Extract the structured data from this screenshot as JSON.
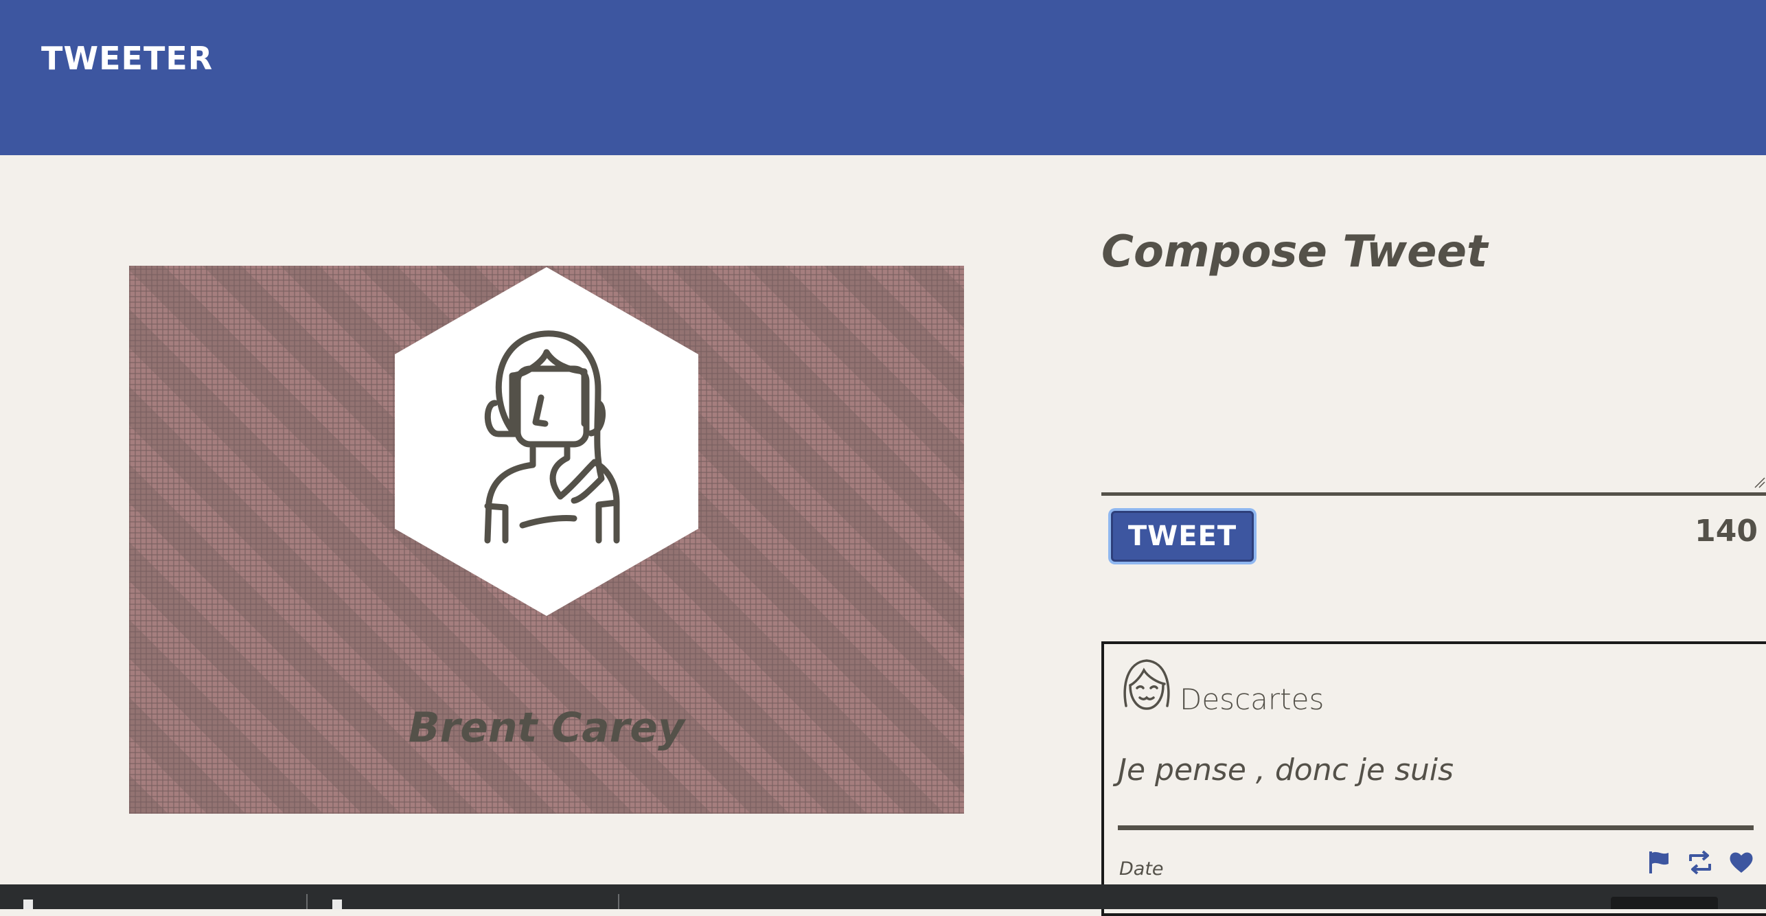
{
  "header": {
    "brand": "TWEETER",
    "color": "#3d56a0"
  },
  "profile": {
    "name": "Brent Carey",
    "avatar_icon": "woman-avatar-icon"
  },
  "compose": {
    "title": "Compose Tweet",
    "text": "",
    "button_label": "TWEET",
    "char_count": "140"
  },
  "tweets": [
    {
      "author": "Descartes",
      "avatar_icon": "girl-face-icon",
      "text": "Je pense , donc je suis",
      "date": "Date",
      "actions": [
        "flag-icon",
        "retweet-icon",
        "heart-icon"
      ]
    }
  ],
  "colors": {
    "accent": "#3d56a0",
    "text": "#545149",
    "background": "#f3f0eb",
    "card": "#9f7878"
  }
}
